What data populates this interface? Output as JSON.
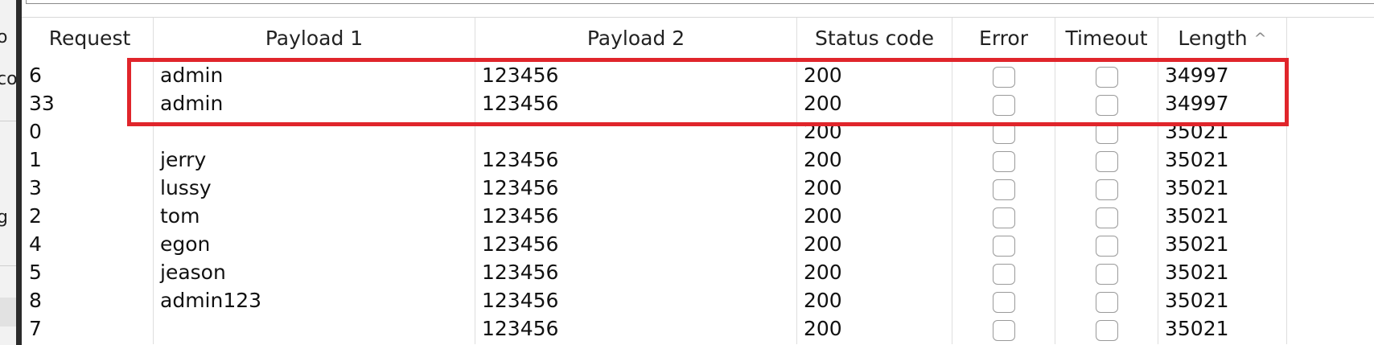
{
  "left_panel": {
    "fragments": [
      "o",
      "co",
      "g"
    ]
  },
  "table": {
    "columns": [
      {
        "label": "Request"
      },
      {
        "label": "Payload 1"
      },
      {
        "label": "Payload 2"
      },
      {
        "label": "Status code"
      },
      {
        "label": "Error"
      },
      {
        "label": "Timeout"
      },
      {
        "label": "Length",
        "sort_icon": "chevron-up-icon",
        "sort_glyph": "^",
        "sort": "ascending"
      }
    ],
    "rows": [
      {
        "request": "6",
        "payload1": "admin",
        "payload2": "123456",
        "status": "200",
        "error": false,
        "timeout": false,
        "length": "34997",
        "highlighted": true
      },
      {
        "request": "33",
        "payload1": "admin",
        "payload2": "123456",
        "status": "200",
        "error": false,
        "timeout": false,
        "length": "34997",
        "highlighted": true
      },
      {
        "request": "0",
        "payload1": "",
        "payload2": "",
        "status": "200",
        "error": false,
        "timeout": false,
        "length": "35021"
      },
      {
        "request": "1",
        "payload1": "jerry",
        "payload2": "123456",
        "status": "200",
        "error": false,
        "timeout": false,
        "length": "35021"
      },
      {
        "request": "3",
        "payload1": "lussy",
        "payload2": "123456",
        "status": "200",
        "error": false,
        "timeout": false,
        "length": "35021"
      },
      {
        "request": "2",
        "payload1": "tom",
        "payload2": "123456",
        "status": "200",
        "error": false,
        "timeout": false,
        "length": "35021"
      },
      {
        "request": "4",
        "payload1": "egon",
        "payload2": "123456",
        "status": "200",
        "error": false,
        "timeout": false,
        "length": "35021"
      },
      {
        "request": "5",
        "payload1": "jeason",
        "payload2": "123456",
        "status": "200",
        "error": false,
        "timeout": false,
        "length": "35021"
      },
      {
        "request": "8",
        "payload1": "admin123",
        "payload2": "123456",
        "status": "200",
        "error": false,
        "timeout": false,
        "length": "35021"
      },
      {
        "request": "7",
        "payload1": "",
        "payload2": "123456",
        "status": "200",
        "error": false,
        "timeout": false,
        "length": "35021"
      }
    ]
  },
  "annotation": {
    "color": "#e0252b",
    "shape": "rectangle around first two rows"
  }
}
